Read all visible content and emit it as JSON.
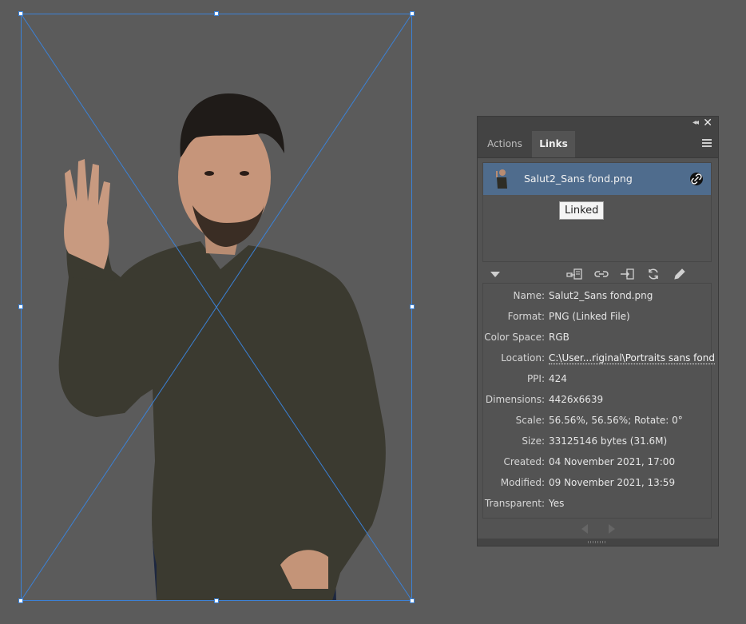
{
  "panel": {
    "tabs": {
      "actions": "Actions",
      "links": "Links"
    },
    "link_item": {
      "name": "Salut2_Sans fond.png",
      "status_icon": "link-icon"
    },
    "tooltip": "Linked",
    "toolbar_icons": [
      "relink-from-cc-icon",
      "relink-icon",
      "go-to-link-icon",
      "update-link-icon",
      "edit-original-icon"
    ],
    "info": [
      {
        "label": "Name:",
        "value": "Salut2_Sans fond.png"
      },
      {
        "label": "Format:",
        "value": "PNG (Linked File)"
      },
      {
        "label": "Color Space:",
        "value": "RGB"
      },
      {
        "label": "Location:",
        "value": "C:\\User...riginal\\Portraits sans fond"
      },
      {
        "label": "PPI:",
        "value": "424"
      },
      {
        "label": "Dimensions:",
        "value": "4426x6639"
      },
      {
        "label": "Scale:",
        "value": "56.56%, 56.56%; Rotate: 0°"
      },
      {
        "label": "Size:",
        "value": "33125146 bytes (31.6M)"
      },
      {
        "label": "Created:",
        "value": "04 November 2021, 17:00"
      },
      {
        "label": "Modified:",
        "value": "09 November 2021, 13:59"
      },
      {
        "label": "Transparent:",
        "value": "Yes"
      }
    ]
  },
  "colors": {
    "canvas": "#5b5b5b",
    "selection": "#3b82d8",
    "selected_row": "#4f6c8d"
  }
}
